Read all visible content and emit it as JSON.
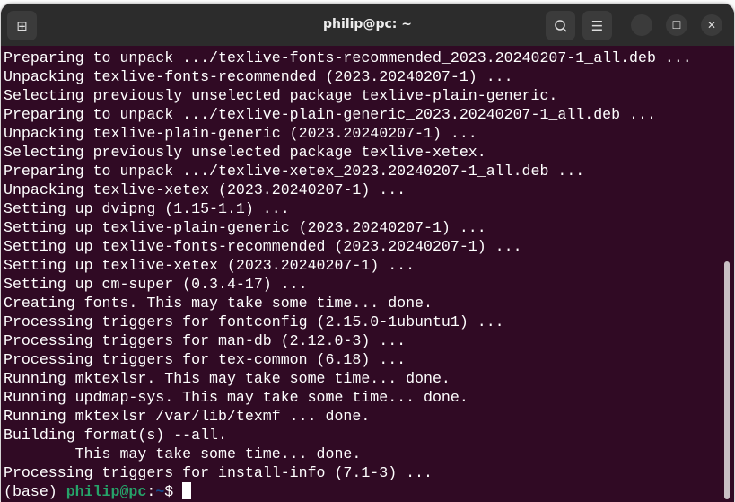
{
  "window": {
    "title": "philip@pc: ~"
  },
  "titlebar": {
    "new_tab_icon": "new-tab-icon",
    "search_icon": "search-icon",
    "menu_icon": "hamburger-menu-icon",
    "minimize_icon": "minimize-icon",
    "maximize_icon": "maximize-icon",
    "close_icon": "close-icon"
  },
  "terminal": {
    "lines": [
      "Preparing to unpack .../texlive-fonts-recommended_2023.20240207-1_all.deb ...",
      "Unpacking texlive-fonts-recommended (2023.20240207-1) ...",
      "Selecting previously unselected package texlive-plain-generic.",
      "Preparing to unpack .../texlive-plain-generic_2023.20240207-1_all.deb ...",
      "Unpacking texlive-plain-generic (2023.20240207-1) ...",
      "Selecting previously unselected package texlive-xetex.",
      "Preparing to unpack .../texlive-xetex_2023.20240207-1_all.deb ...",
      "Unpacking texlive-xetex (2023.20240207-1) ...",
      "Setting up dvipng (1.15-1.1) ...",
      "Setting up texlive-plain-generic (2023.20240207-1) ...",
      "Setting up texlive-fonts-recommended (2023.20240207-1) ...",
      "Setting up texlive-xetex (2023.20240207-1) ...",
      "Setting up cm-super (0.3.4-17) ...",
      "Creating fonts. This may take some time... done.",
      "Processing triggers for fontconfig (2.15.0-1ubuntu1) ...",
      "Processing triggers for man-db (2.12.0-3) ...",
      "Processing triggers for tex-common (6.18) ...",
      "Running mktexlsr. This may take some time... done.",
      "Running updmap-sys. This may take some time... done.",
      "Running mktexlsr /var/lib/texmf ... done.",
      "Building format(s) --all.",
      "        This may take some time... done.",
      "Processing triggers for install-info (7.1-3) ..."
    ],
    "prompt": {
      "env": "(base) ",
      "user_host": "philip@pc",
      "sep": ":",
      "path": "~",
      "symbol": "$ "
    },
    "colors": {
      "background": "#300a24",
      "user_host": "#26a269",
      "path": "#12488b"
    }
  }
}
